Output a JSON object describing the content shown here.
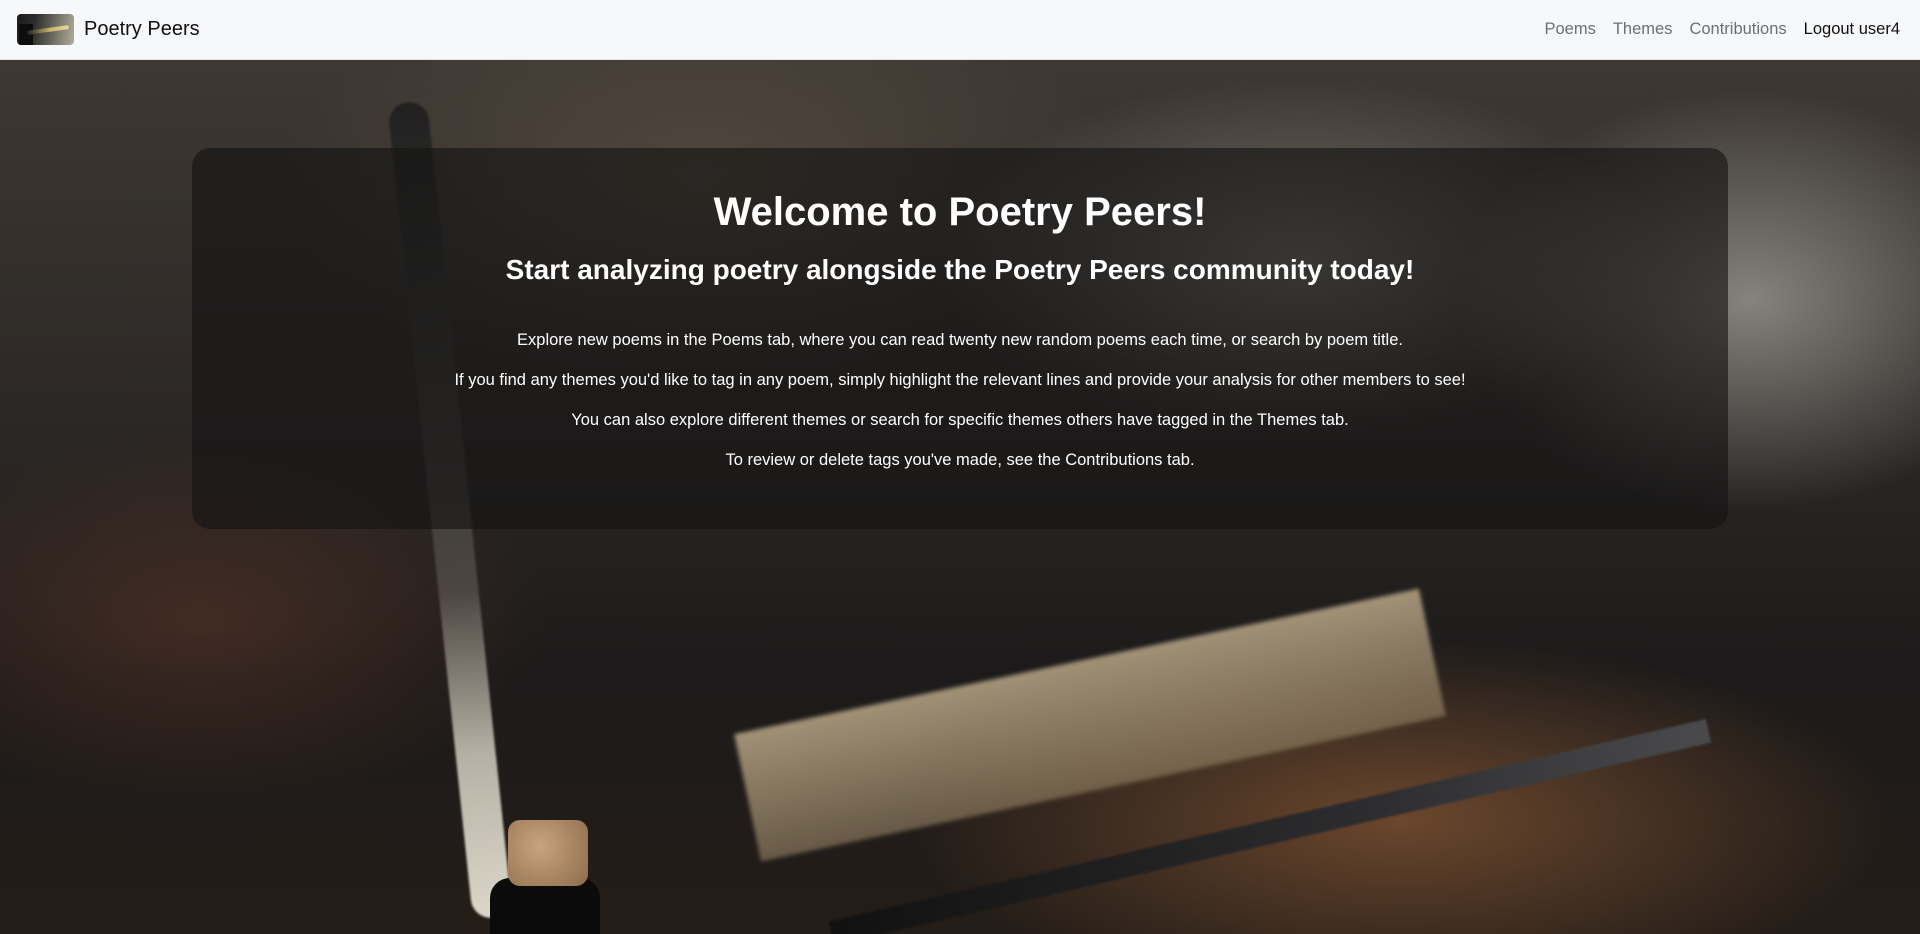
{
  "navbar": {
    "brand_logo_icon": "quill-and-inkwell-icon",
    "brand_name": "Poetry Peers",
    "links": [
      {
        "label": "Poems"
      },
      {
        "label": "Themes"
      },
      {
        "label": "Contributions"
      },
      {
        "label": "Logout user4"
      }
    ]
  },
  "hero": {
    "title": "Welcome to Poetry Peers!",
    "subtitle": "Start analyzing poetry alongside the Poetry Peers community today!",
    "paragraphs": [
      "Explore new poems in the Poems tab, where you can read twenty new random poems each time, or search by poem title.",
      "If you find any themes you'd like to tag in any poem, simply highlight the relevant lines and provide your analysis for other members to see!",
      "You can also explore different themes or search for specific themes others have tagged in the Themes tab.",
      "To review or delete tags you've made, see the Contributions tab."
    ]
  },
  "colors": {
    "navbar_bg": "#f7f8fa",
    "panel_bg": "rgba(20,20,20,0.62)",
    "nav_link": "#6c6f73",
    "nav_link_active": "#111111"
  }
}
